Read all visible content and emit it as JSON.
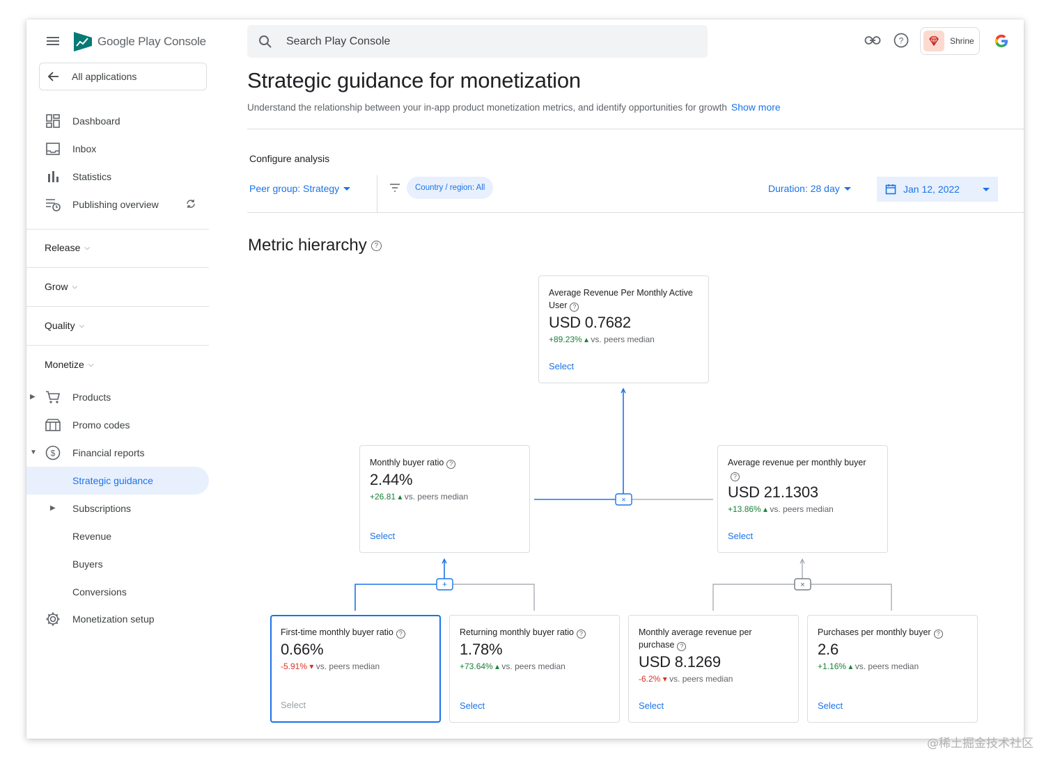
{
  "brand": {
    "name_part1": "Google Play",
    "name_part2": "Console"
  },
  "sidebar": {
    "all_apps": "All applications",
    "top_items": [
      {
        "label": "Dashboard",
        "icon": "dashboard-icon"
      },
      {
        "label": "Inbox",
        "icon": "inbox-icon"
      },
      {
        "label": "Statistics",
        "icon": "statistics-icon"
      },
      {
        "label": "Publishing overview",
        "icon": "publishing-icon"
      }
    ],
    "sections": [
      "Release",
      "Grow",
      "Quality",
      "Monetize"
    ],
    "monetize_items": [
      {
        "label": "Products",
        "icon": "cart-icon"
      },
      {
        "label": "Promo codes",
        "icon": "promo-icon"
      },
      {
        "label": "Financial reports",
        "icon": "dollar-icon"
      },
      {
        "label": "Strategic guidance"
      },
      {
        "label": "Subscriptions"
      },
      {
        "label": "Revenue"
      },
      {
        "label": "Buyers"
      },
      {
        "label": "Conversions"
      },
      {
        "label": "Monetization setup",
        "icon": "gear-icon"
      }
    ]
  },
  "topbar": {
    "search_placeholder": "Search Play Console",
    "account": "Shrine"
  },
  "page": {
    "title": "Strategic guidance for monetization",
    "subtitle": "Understand the relationship between your in-app product monetization metrics, and identify opportunities for growth",
    "show_more": "Show more"
  },
  "config": {
    "title": "Configure analysis",
    "peer_group": "Peer group: Strategy",
    "country_chip": "Country / region: All",
    "duration": "Duration: 28 day",
    "date": "Jan 12, 2022"
  },
  "hierarchy": {
    "title": "Metric hierarchy",
    "select_label": "Select",
    "vs_label": "vs. peers median",
    "cards": [
      {
        "name": "Average Revenue Per Monthly Active User",
        "value": "USD 0.7682",
        "delta": "+89.23%",
        "trend": "up"
      },
      {
        "name": "Monthly buyer ratio",
        "value": "2.44%",
        "delta": "+26.81",
        "trend": "up"
      },
      {
        "name": "Average revenue per monthly buyer",
        "value": "USD 21.1303",
        "delta": "+13.86%",
        "trend": "up"
      },
      {
        "name": "First-time monthly buyer ratio",
        "value": "0.66%",
        "delta": "-5.91%",
        "trend": "down"
      },
      {
        "name": "Returning monthly buyer ratio",
        "value": "1.78%",
        "delta": "+73.64%",
        "trend": "up"
      },
      {
        "name": "Monthly average revenue per purchase",
        "value": "USD 8.1269",
        "delta": "-6.2%",
        "trend": "down"
      },
      {
        "name": "Purchases per monthly buyer",
        "value": "2.6",
        "delta": "+1.16%",
        "trend": "up"
      }
    ],
    "operators": {
      "top": "×",
      "left": "+",
      "right": "×"
    }
  },
  "colors": {
    "accent": "#1a73e8",
    "positive": "#188038",
    "negative": "#d93025",
    "active_bg": "#e8f0fe"
  },
  "watermark": "@稀土掘金技术社区"
}
